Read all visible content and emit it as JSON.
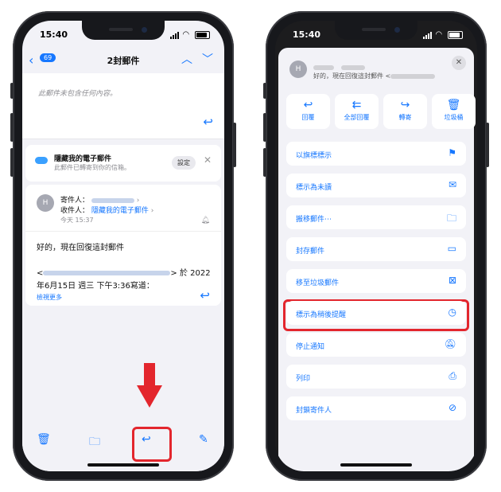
{
  "left": {
    "status": {
      "time": "15:40"
    },
    "nav": {
      "badge": "69",
      "title": "2封郵件"
    },
    "empty_message": "此郵件未包含任何內容。",
    "hide_card": {
      "title": "隱藏我的電子郵件",
      "subtitle": "此郵件已轉寄到你的信箱。",
      "settings": "設定"
    },
    "message": {
      "avatar": "H",
      "sender_label": "寄件人：",
      "recipient_label": "收件人：",
      "recipient": "隱藏我的電子郵件",
      "date": "今天 15:37",
      "greeting": "好的，現在回復這封郵件",
      "quote_suffix": "> 於 2022",
      "quote_line2": "年6月15日 週三 下午3:36寫道：",
      "more": "檢視更多"
    }
  },
  "right": {
    "status": {
      "time": "15:40"
    },
    "sheet": {
      "avatar": "H",
      "preview": "好的，現在回復這封郵件 <",
      "actions": [
        {
          "label": "回覆",
          "icon": "reply-icon"
        },
        {
          "label": "全部回覆",
          "icon": "reply-all-icon"
        },
        {
          "label": "轉寄",
          "icon": "forward-icon"
        },
        {
          "label": "垃圾桶",
          "icon": "trash-icon"
        }
      ],
      "menu": [
        {
          "label": "以旗標標示",
          "icon": "flag-icon"
        },
        {
          "label": "標示為未讀",
          "icon": "unread-envelope-icon"
        },
        {
          "label": "搬移郵件⋯",
          "icon": "folder-icon"
        },
        {
          "label": "封存郵件",
          "icon": "archive-icon"
        },
        {
          "label": "移至垃圾郵件",
          "icon": "junk-icon"
        },
        {
          "label": "標示為稍後提醒",
          "icon": "clock-icon"
        },
        {
          "label": "停止通知",
          "icon": "bell-slash-icon"
        },
        {
          "label": "列印",
          "icon": "printer-icon"
        },
        {
          "label": "封鎖寄件人",
          "icon": "block-icon"
        }
      ]
    }
  },
  "colors": {
    "accent": "#1677ff",
    "highlight": "#e3262d"
  }
}
